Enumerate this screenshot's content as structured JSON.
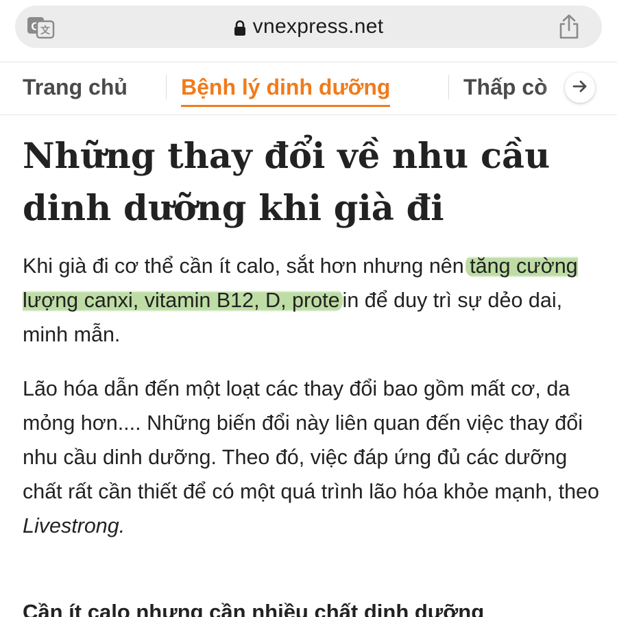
{
  "browser": {
    "domain": "vnexpress.net",
    "icons": {
      "translate": "translate-icon",
      "lock": "lock-icon",
      "share": "share-icon"
    }
  },
  "nav": {
    "items": [
      {
        "label": "Trang chủ",
        "active": false
      },
      {
        "label": "Bệnh lý dinh dưỡng",
        "active": true
      },
      {
        "label": "Thấp cò",
        "active": false
      }
    ],
    "accent_color": "#f07b1b",
    "next_icon": "arrow-right-icon"
  },
  "article": {
    "title": "Những thay đổi về nhu cầu dinh dưỡng khi già đi",
    "lead": {
      "before": "Khi già đi cơ thể cần ít calo, sắt hơn nhưng nên ",
      "highlighted": "tăng cường lượng canxi, vitamin B12, D, prote",
      "after": "in để duy trì sự dẻo dai, minh mẫn."
    },
    "highlight_color": "#96c86e",
    "body": {
      "text": "Lão hóa dẫn đến một loạt các thay đổi bao gồm mất cơ, da mỏng hơn.... Những biến đổi này liên quan đến việc thay đổi nhu cầu dinh dưỡng. Theo đó, việc đáp ứng đủ các dưỡng chất rất cần thiết để có một quá trình lão hóa khỏe mạnh, theo ",
      "source": "Livestrong."
    },
    "subheading": "Cần ít calo nhưng cần nhiều chất dinh dưỡng"
  }
}
